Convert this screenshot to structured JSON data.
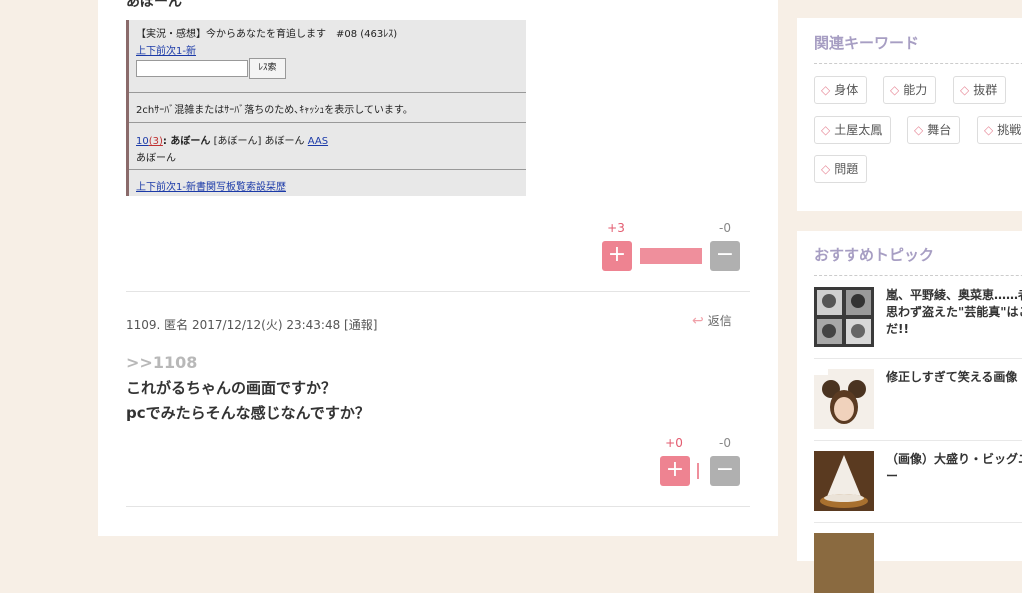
{
  "post_prev": {
    "cut_text": "あぼーん",
    "embedded": {
      "title": "【実況・感想】今からあなたを育追します　#08 (463ﾚｽ)",
      "nav_top": "上下前次1-新",
      "search_button": "ﾚｽ索",
      "notice": "2chｻｰﾊﾞ混雑またはｻｰﾊﾞ落ちのため､ｷｬｯｼｭを表示しています。",
      "res_num": "10",
      "res_count": "(3)",
      "res_name": ": あぼーん",
      "res_rest": " [あぼーん] あぼーん ",
      "res_aas": "AAS",
      "res_body": "あぼーん",
      "nav_bottom": "上下前次1-新書関写板覧索設栞歴"
    },
    "vote": {
      "plus": "+3",
      "minus": "-0",
      "plus_ratio": 1.0
    }
  },
  "post": {
    "meta": "1109. 匿名 2017/12/12(火) 23:43:48  [通報]",
    "reply_label": "返信",
    "anchor": ">>1108",
    "body_lines": [
      "これがるちゃんの画面ですか？",
      "pcでみたらそんな感じなんですか？"
    ],
    "vote": {
      "plus": "+0",
      "minus": "-0",
      "plus_ratio": 0
    }
  },
  "sidebar": {
    "keywords": {
      "title": "関連キーワード",
      "tags": [
        "身体",
        "能力",
        "抜群",
        "土屋太鳳",
        "舞台",
        "挑戦",
        "問題"
      ]
    },
    "topics": {
      "title": "おすすめトピック",
      "items": [
        {
          "title": "嵐、平野綾、奥菜恵……者が思わず盗えた\"芸能真\"はこれだ!!"
        },
        {
          "title": "修正しすぎて笑える画像"
        },
        {
          "title": "（画像）大盛り・ビッグニュー"
        }
      ]
    }
  },
  "colors": {
    "background": "#f7efe6",
    "accent_pink": "#ee8391",
    "sidebar_title": "#a79ec3"
  }
}
